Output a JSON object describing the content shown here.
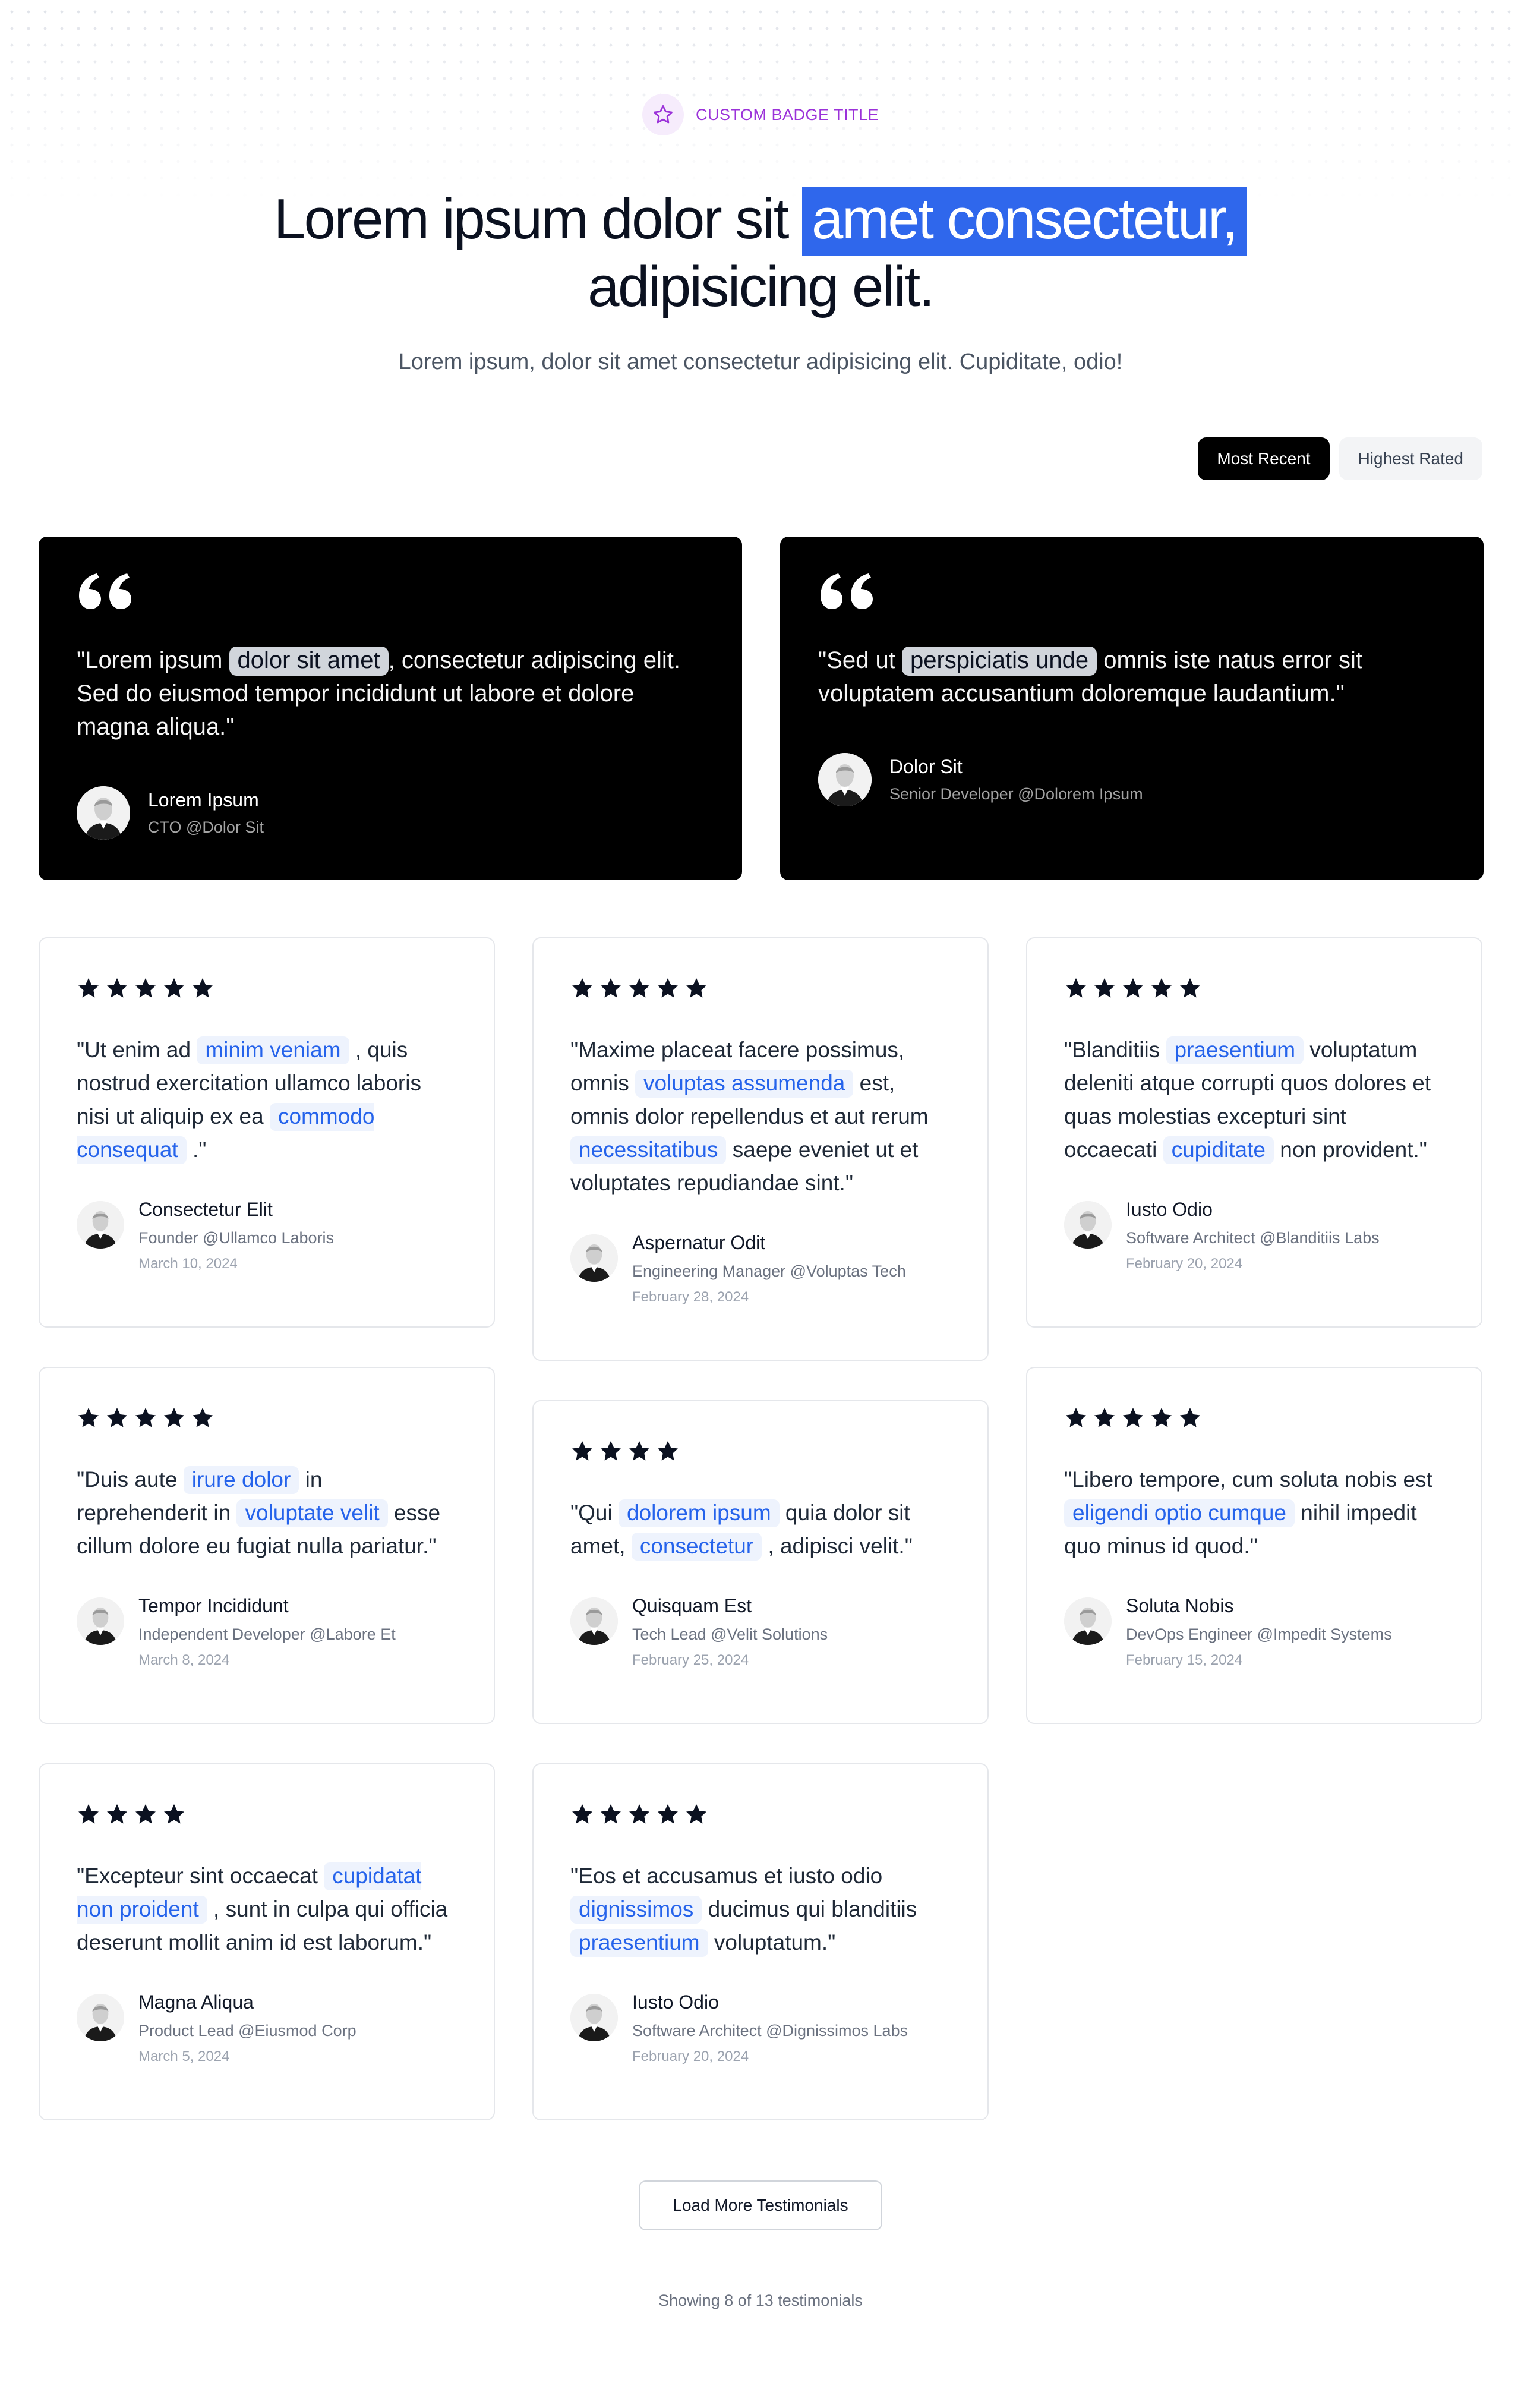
{
  "badge": {
    "title": "CUSTOM BADGE TITLE",
    "icon": "star-outline-icon",
    "color": "#9b32d9"
  },
  "hero": {
    "title_before": "Lorem ipsum dolor sit",
    "title_highlight": "amet consectetur,",
    "title_after": "adipisicing elit.",
    "subtitle": "Lorem ipsum, dolor sit amet consectetur adipisicing elit. Cupiditate, odio!",
    "highlight_color": "#2f67ec"
  },
  "sort": {
    "options": [
      "Most Recent",
      "Highest Rated"
    ],
    "selected": "Most Recent"
  },
  "featured": [
    {
      "quote_before": "\"Lorem ipsum ",
      "chip": "dolor sit amet",
      "quote_after": ", consectetur adipiscing elit. Sed do eiusmod tempor incididunt ut labore et dolore magna aliqua.\"",
      "name": "Lorem Ipsum",
      "role": "CTO @Dolor Sit"
    },
    {
      "quote_before": "\"Sed ut ",
      "chip": "perspiciatis unde",
      "quote_after": " omnis iste natus error sit voluptatem accusantium doloremque laudantium.\"",
      "name": "Dolor Sit",
      "role": "Senior Developer @Dolorem Ipsum"
    }
  ],
  "testimonials": [
    {
      "rating": 5,
      "quote": [
        {
          "t": "\"Ut enim ad "
        },
        {
          "t": "minim veniam",
          "hl": true
        },
        {
          "t": " , quis nostrud exercitation ullamco laboris nisi ut aliquip ex ea "
        },
        {
          "t": "commodo consequat",
          "hl": true
        },
        {
          "t": " .\""
        }
      ],
      "name": "Consectetur Elit",
      "role": "Founder @Ullamco Laboris",
      "date": "March 10, 2024"
    },
    {
      "rating": 5,
      "quote": [
        {
          "t": "\"Maxime placeat facere possimus, omnis "
        },
        {
          "t": "voluptas assumenda",
          "hl": true
        },
        {
          "t": " est, omnis dolor repellendus et aut rerum "
        },
        {
          "t": "necessitatibus",
          "hl": true
        },
        {
          "t": " saepe eveniet ut et voluptates repudiandae sint.\""
        }
      ],
      "name": "Aspernatur Odit",
      "role": "Engineering Manager @Voluptas Tech",
      "date": "February 28, 2024"
    },
    {
      "rating": 5,
      "quote": [
        {
          "t": "\"Blanditiis "
        },
        {
          "t": "praesentium",
          "hl": true
        },
        {
          "t": " voluptatum deleniti atque corrupti quos dolores et quas molestias excepturi sint occaecati "
        },
        {
          "t": "cupiditate",
          "hl": true
        },
        {
          "t": " non provident.\""
        }
      ],
      "name": "Iusto Odio",
      "role": "Software Architect @Blanditiis Labs",
      "date": "February 20, 2024"
    },
    {
      "rating": 5,
      "quote": [
        {
          "t": "\"Duis aute "
        },
        {
          "t": "irure dolor",
          "hl": true
        },
        {
          "t": " in reprehenderit in "
        },
        {
          "t": "voluptate velit",
          "hl": true
        },
        {
          "t": " esse cillum dolore eu fugiat nulla pariatur.\""
        }
      ],
      "name": "Tempor Incididunt",
      "role": "Independent Developer @Labore Et",
      "date": "March 8, 2024"
    },
    {
      "rating": 4,
      "quote": [
        {
          "t": "\"Qui "
        },
        {
          "t": "dolorem ipsum",
          "hl": true
        },
        {
          "t": " quia dolor sit amet, "
        },
        {
          "t": "consectetur",
          "hl": true
        },
        {
          "t": " , adipisci velit.\""
        }
      ],
      "name": "Quisquam Est",
      "role": "Tech Lead @Velit Solutions",
      "date": "February 25, 2024"
    },
    {
      "rating": 5,
      "quote": [
        {
          "t": "\"Libero tempore, cum soluta nobis est "
        },
        {
          "t": "eligendi optio cumque",
          "hl": true
        },
        {
          "t": " nihil impedit quo minus id quod.\""
        }
      ],
      "name": "Soluta Nobis",
      "role": "DevOps Engineer @Impedit Systems",
      "date": "February 15, 2024"
    },
    {
      "rating": 4,
      "quote": [
        {
          "t": "\"Excepteur sint occaecat "
        },
        {
          "t": "cupidatat non proident",
          "hl": true
        },
        {
          "t": " , sunt in culpa qui officia deserunt mollit anim id est laborum.\""
        }
      ],
      "name": "Magna Aliqua",
      "role": "Product Lead @Eiusmod Corp",
      "date": "March 5, 2024"
    },
    {
      "rating": 5,
      "quote": [
        {
          "t": "\"Eos et accusamus et iusto odio "
        },
        {
          "t": "dignissimos",
          "hl": true
        },
        {
          "t": " ducimus qui blanditiis "
        },
        {
          "t": "praesentium",
          "hl": true
        },
        {
          "t": " voluptatum.\""
        }
      ],
      "name": "Iusto Odio",
      "role": "Software Architect @Dignissimos Labs",
      "date": "February 20, 2024"
    }
  ],
  "load_more": "Load More Testimonials",
  "showing": "Showing 8 of 13 testimonials",
  "colors": {
    "chip_text": "#2563eb",
    "chip_bg": "#eef3fd",
    "star": "#0b1120"
  }
}
